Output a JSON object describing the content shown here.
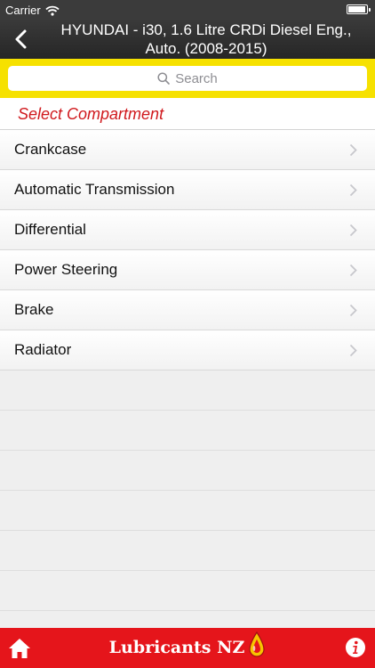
{
  "status_bar": {
    "carrier": "Carrier",
    "time": "",
    "icons": [
      "wifi-icon",
      "battery-icon"
    ]
  },
  "nav": {
    "back_icon": "back-chevron-icon",
    "title": "HYUNDAI - i30, 1.6 Litre CRDi Diesel Eng.,\nAuto. (2008-2015)"
  },
  "search": {
    "placeholder": "Search",
    "icon": "search-icon"
  },
  "section": {
    "title": "Select Compartment"
  },
  "compartments": [
    {
      "label": "Crankcase"
    },
    {
      "label": "Automatic Transmission"
    },
    {
      "label": "Differential"
    },
    {
      "label": "Power Steering"
    },
    {
      "label": "Brake"
    },
    {
      "label": "Radiator"
    }
  ],
  "tab_bar": {
    "brand": "Lubricants NZ",
    "home_icon": "home-icon",
    "info_icon": "info-icon",
    "logo_icon": "oil-drop-icon"
  },
  "colors": {
    "accent": "#e5151b",
    "search_bar": "#f6e100",
    "section_title": "#d0191d",
    "nav": "#2f2f2f"
  }
}
